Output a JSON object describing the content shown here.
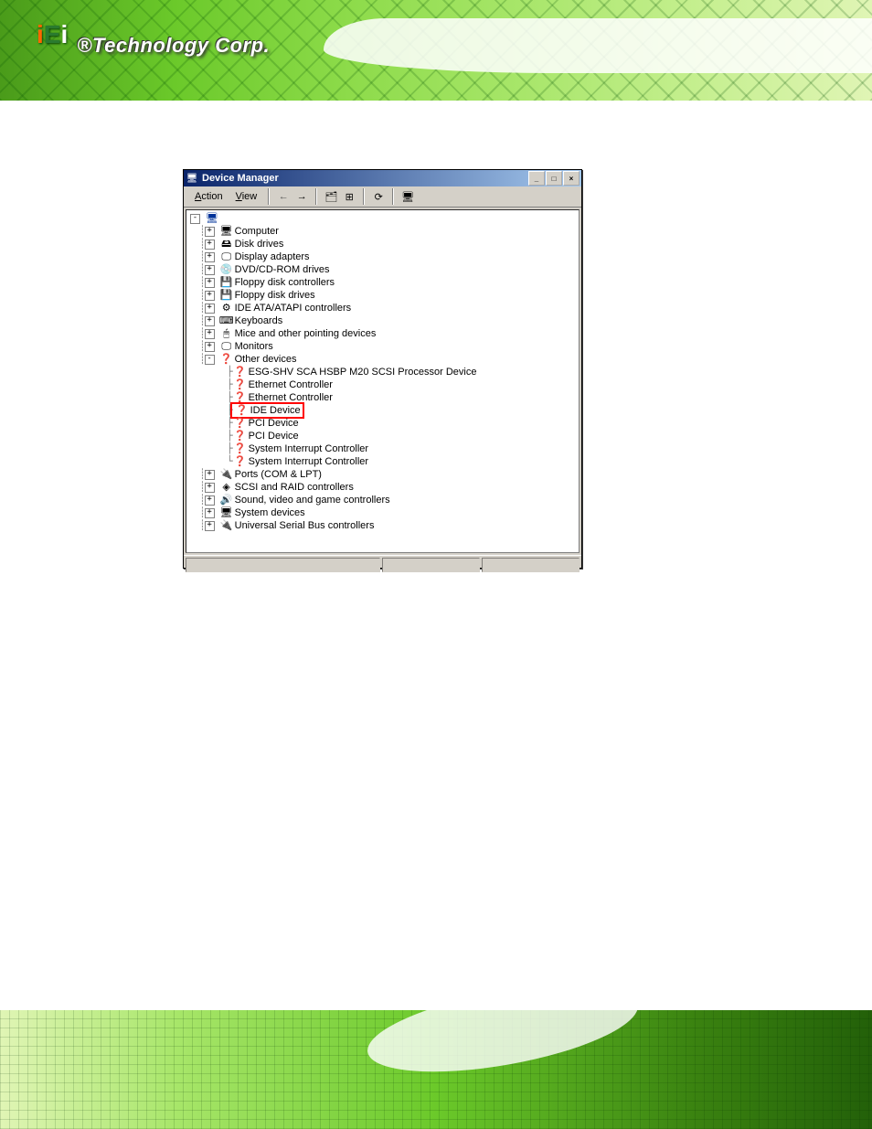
{
  "logo": {
    "brand_text": "®Technology Corp."
  },
  "window": {
    "title": "Device Manager",
    "titlebar_icon": "🖥",
    "menu": {
      "action": "Action",
      "view": "View"
    },
    "toolbar": {
      "back": "←",
      "forward": "→",
      "icon1": "🗂",
      "icon2": "⊞",
      "icon3": "⟳",
      "icon4": "🖥"
    },
    "win_buttons": {
      "min": "_",
      "max": "□",
      "close": "×"
    }
  },
  "tree": {
    "root_icon": "🖥",
    "items": [
      {
        "icon": "🖥",
        "label": "Computer",
        "expandable": true
      },
      {
        "icon": "🖴",
        "label": "Disk drives",
        "expandable": true
      },
      {
        "icon": "🖵",
        "label": "Display adapters",
        "expandable": true
      },
      {
        "icon": "💿",
        "label": "DVD/CD-ROM drives",
        "expandable": true
      },
      {
        "icon": "💾",
        "label": "Floppy disk controllers",
        "expandable": true
      },
      {
        "icon": "💾",
        "label": "Floppy disk drives",
        "expandable": true
      },
      {
        "icon": "⚙",
        "label": "IDE ATA/ATAPI controllers",
        "expandable": true
      },
      {
        "icon": "⌨",
        "label": "Keyboards",
        "expandable": true
      },
      {
        "icon": "🖱",
        "label": "Mice and other pointing devices",
        "expandable": true
      },
      {
        "icon": "🖵",
        "label": "Monitors",
        "expandable": true
      },
      {
        "icon": "❓",
        "label": "Other devices",
        "expandable": true,
        "expanded": true,
        "children": [
          {
            "icon": "❓",
            "label": "ESG-SHV SCA HSBP M20 SCSI Processor Device"
          },
          {
            "icon": "❓",
            "label": "Ethernet Controller"
          },
          {
            "icon": "❓",
            "label": "Ethernet Controller"
          },
          {
            "icon": "❓",
            "label": "IDE Device",
            "highlight": true
          },
          {
            "icon": "❓",
            "label": "PCI Device"
          },
          {
            "icon": "❓",
            "label": "PCI Device"
          },
          {
            "icon": "❓",
            "label": "System Interrupt Controller"
          },
          {
            "icon": "❓",
            "label": "System Interrupt Controller"
          }
        ]
      },
      {
        "icon": "🔌",
        "label": "Ports (COM & LPT)",
        "expandable": true
      },
      {
        "icon": "◈",
        "label": "SCSI and RAID controllers",
        "expandable": true
      },
      {
        "icon": "🔊",
        "label": "Sound, video and game controllers",
        "expandable": true
      },
      {
        "icon": "🖥",
        "label": "System devices",
        "expandable": true
      },
      {
        "icon": "🔌",
        "label": "Universal Serial Bus controllers",
        "expandable": true
      }
    ]
  }
}
